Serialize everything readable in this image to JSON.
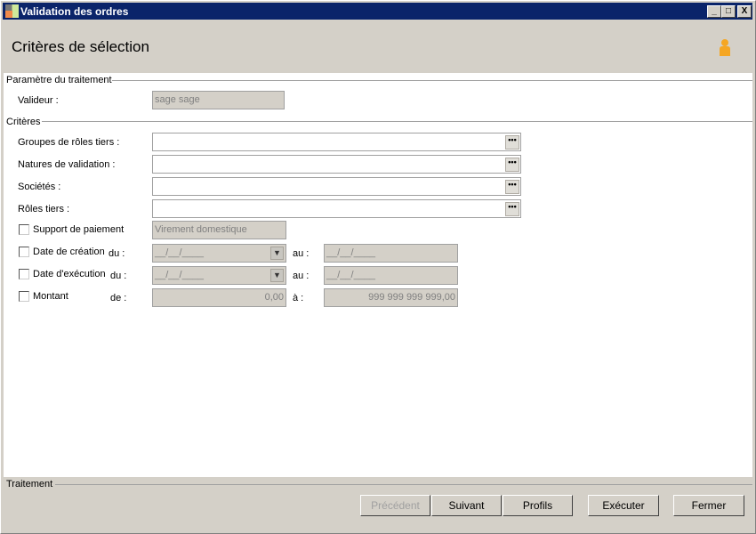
{
  "window": {
    "title": "Validation des ordres",
    "minimize": "_",
    "maximize": "□",
    "close": "X"
  },
  "header": {
    "title": "Critères de sélection",
    "icon": "user-icon"
  },
  "param_group": {
    "title": "Paramètre du traitement",
    "validateur_label": "Valideur :",
    "validateur_value": "sage sage"
  },
  "criteria": {
    "title": "Critères",
    "rows": [
      {
        "label": "Groupes de rôles tiers :",
        "value": ""
      },
      {
        "label": "Natures de validation :",
        "value": ""
      },
      {
        "label": "Sociétés :",
        "value": ""
      },
      {
        "label": "Rôles tiers :",
        "value": ""
      }
    ],
    "ellipsis": "•••",
    "support": {
      "label": "Support de paiement",
      "value": "Virement domestique",
      "checked": false
    },
    "date_creation": {
      "label": "Date de création",
      "from_label": "du :",
      "from": "__/__/____",
      "to_label": "au :",
      "to": "__/__/____",
      "checked": false
    },
    "date_execution": {
      "label": "Date d'exécution",
      "from_label": "du :",
      "from": "__/__/____",
      "to_label": "au :",
      "to": "__/__/____",
      "checked": false
    },
    "montant": {
      "label": "Montant",
      "from_label": "de :",
      "from": "0,00",
      "to_label": "à :",
      "to": "999 999 999 999,00",
      "checked": false
    }
  },
  "footer": {
    "title": "Traitement",
    "buttons": {
      "previous": "Précédent",
      "next": "Suivant",
      "profiles": "Profils",
      "execute": "Exécuter",
      "close": "Fermer"
    }
  }
}
